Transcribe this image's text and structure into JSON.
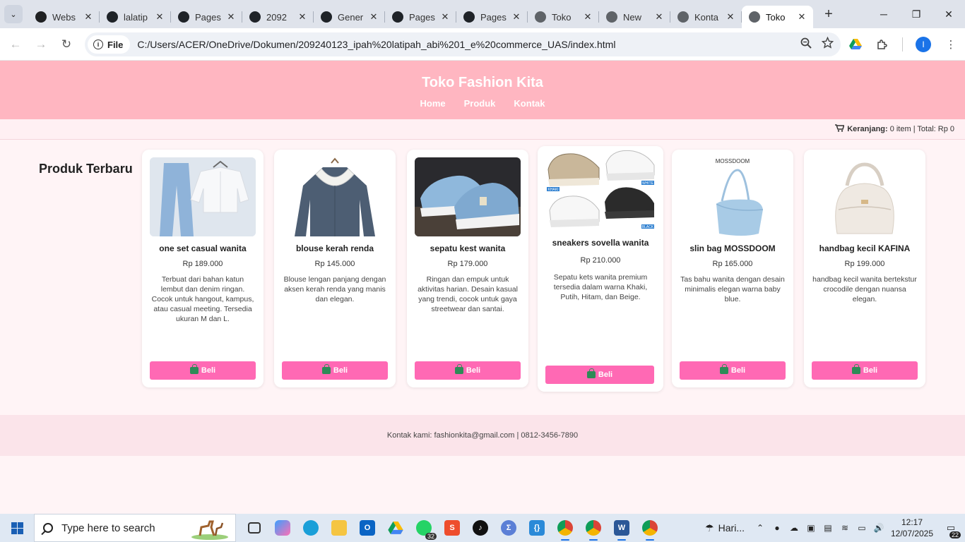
{
  "browser": {
    "tabs": [
      {
        "title": "Webs",
        "icon": "openai-icon",
        "active": false
      },
      {
        "title": "lalatip",
        "icon": "github-icon",
        "active": false
      },
      {
        "title": "Pages",
        "icon": "github-icon",
        "active": false
      },
      {
        "title": "2092",
        "icon": "github-icon",
        "active": false
      },
      {
        "title": "Gener",
        "icon": "github-icon",
        "active": false
      },
      {
        "title": "Pages",
        "icon": "github-icon",
        "active": false
      },
      {
        "title": "Pages",
        "icon": "github-icon",
        "active": false
      },
      {
        "title": "Toko",
        "icon": "chrome-icon",
        "active": false
      },
      {
        "title": "New",
        "icon": "chrome-icon",
        "active": false
      },
      {
        "title": "Konta",
        "icon": "chrome-icon",
        "active": false
      },
      {
        "title": "Toko",
        "icon": "chrome-icon",
        "active": true
      }
    ],
    "site_chip": "File",
    "url": "C:/Users/ACER/OneDrive/Dokumen/209240123_ipah%20latipah_abi%201_e%20commerce_UAS/index.html",
    "profile_initial": "I"
  },
  "site": {
    "title": "Toko Fashion Kita",
    "nav": [
      "Home",
      "Produk",
      "Kontak"
    ],
    "cart_label": "Keranjang:",
    "cart_summary": "0 item | Total: Rp 0",
    "section_title": "Produk Terbaru",
    "buy_label": "Beli",
    "footer": "Kontak kami: fashionkita@gmail.com | 0812-3456-7890",
    "accent_color": "#ff69b4",
    "header_color": "#ffb6c1"
  },
  "products": [
    {
      "name": "one set casual wanita",
      "price": "Rp 189.000",
      "desc": "Terbuat dari bahan katun lembut dan denim ringan. Cocok untuk hangout, kampus, atau casual meeting. Tersedia ukuran M dan L."
    },
    {
      "name": "blouse kerah renda",
      "price": "Rp 145.000",
      "desc": "Blouse lengan panjang dengan aksen kerah renda yang manis dan elegan."
    },
    {
      "name": "sepatu kest wanita",
      "price": "Rp 179.000",
      "desc": "Ringan dan empuk untuk aktivitas harian. Desain kasual yang trendi, cocok untuk gaya streetwear dan santai."
    },
    {
      "name": "sneakers sovella wanita",
      "price": "Rp 210.000",
      "desc": "Sepatu kets wanita premium tersedia dalam warna Khaki, Putih, Hitam, dan Beige."
    },
    {
      "name": "slin bag MOSSDOOM",
      "price": "Rp 165.000",
      "desc": "Tas bahu wanita dengan desain minimalis elegan warna baby blue.",
      "img_brand": "MOSSDOOM"
    },
    {
      "name": "handbag kecil KAFINA",
      "price": "Rp 199.000",
      "desc": "handbag kecil wanita bertekstur crocodile dengan nuansa elegan."
    }
  ],
  "sneaker_tags": [
    "KHAKI",
    "WHITE",
    "BLACK"
  ],
  "taskbar": {
    "search_placeholder": "Type here to search",
    "whatsapp_badge": "32",
    "weather": "Hari...",
    "time": "12:17",
    "date": "12/07/2025",
    "notifications": "22"
  }
}
